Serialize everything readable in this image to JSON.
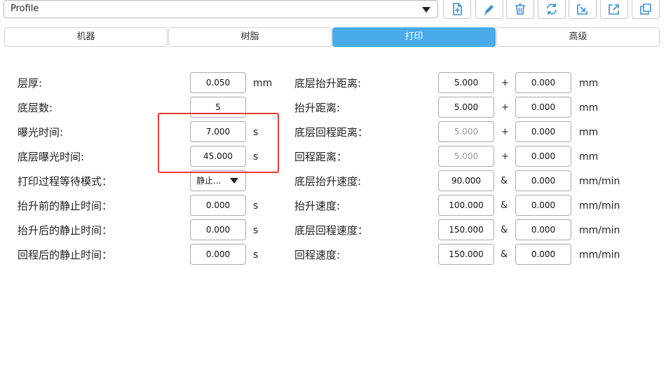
{
  "profile": {
    "selected": "Profile"
  },
  "toolbar": {
    "icons": [
      "new-file-icon",
      "edit-icon",
      "trash-icon",
      "refresh-icon",
      "import-icon",
      "export-icon",
      "copy-icon"
    ],
    "accent": "#4aabea"
  },
  "tabs": [
    {
      "label": "机器",
      "active": false
    },
    {
      "label": "树脂",
      "active": false
    },
    {
      "label": "打印",
      "active": true
    },
    {
      "label": "高级",
      "active": false
    }
  ],
  "left": {
    "layer_height": {
      "label": "层厚:",
      "value": "0.050",
      "unit": "mm"
    },
    "bottom_layers": {
      "label": "底层数:",
      "value": "5"
    },
    "exposure_time": {
      "label": "曝光时间:",
      "value": "7.000",
      "unit": "s"
    },
    "bottom_exposure_time": {
      "label": "底层曝光时间:",
      "value": "45.000",
      "unit": "s"
    },
    "wait_mode": {
      "label": "打印过程等待模式：",
      "value": "静止..."
    },
    "rest_before_lift": {
      "label": "抬升前的静止时间：",
      "value": "0.000",
      "unit": "s"
    },
    "rest_after_lift": {
      "label": "抬升后的静止时间：",
      "value": "0.000",
      "unit": "s"
    },
    "rest_after_retract": {
      "label": "回程后的静止时间：",
      "value": "0.000",
      "unit": "s"
    }
  },
  "right": {
    "bottom_lift_distance": {
      "label": "底层抬升距离:",
      "value1": "5.000",
      "op": "+",
      "value2": "0.000",
      "unit": "mm"
    },
    "lift_distance": {
      "label": "抬升距离:",
      "value1": "5.000",
      "op": "+",
      "value2": "0.000",
      "unit": "mm"
    },
    "bottom_retract_distance": {
      "label": "底层回程距离：",
      "value1": "5.000",
      "op": "+",
      "value2": "0.000",
      "unit": "mm"
    },
    "retract_distance": {
      "label": "回程距离：",
      "value1": "5.000",
      "op": "+",
      "value2": "0.000",
      "unit": "mm"
    },
    "bottom_lift_speed": {
      "label": "底层抬升速度:",
      "value1": "90.000",
      "op": "&",
      "value2": "0.000",
      "unit": "mm/min"
    },
    "lift_speed": {
      "label": "抬升速度:",
      "value1": "100.000",
      "op": "&",
      "value2": "0.000",
      "unit": "mm/min"
    },
    "bottom_retract_speed": {
      "label": "底层回程速度：",
      "value1": "150.000",
      "op": "&",
      "value2": "0.000",
      "unit": "mm/min"
    },
    "retract_speed": {
      "label": "回程速度:",
      "value1": "150.000",
      "op": "&",
      "value2": "0.000",
      "unit": "mm/min"
    }
  }
}
